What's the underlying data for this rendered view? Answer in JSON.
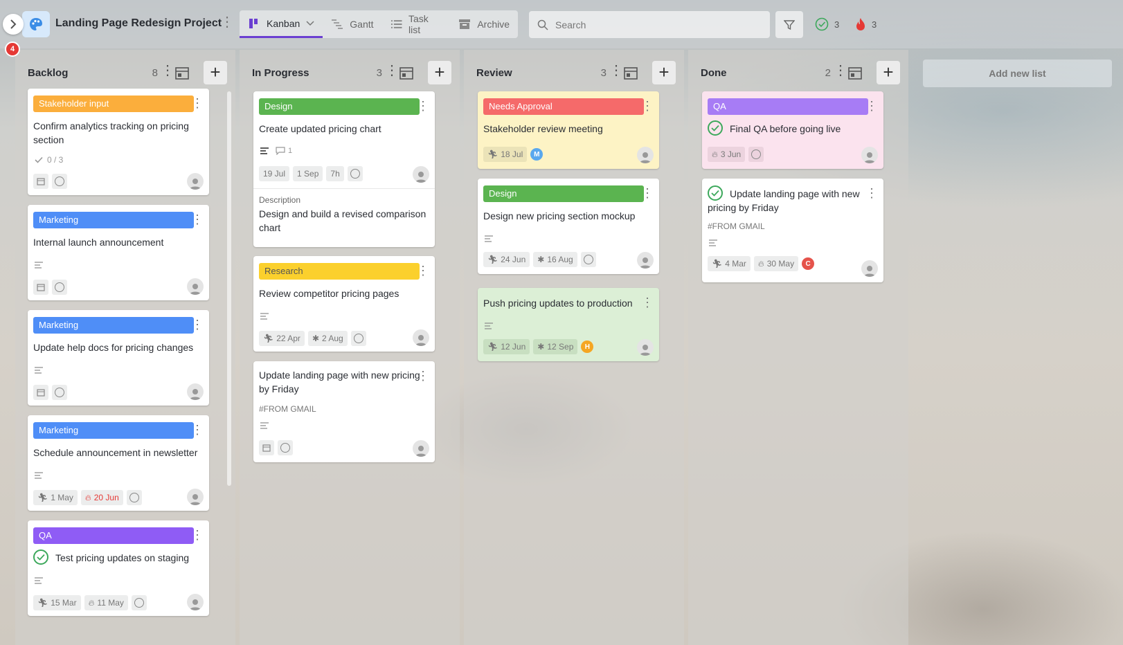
{
  "header": {
    "notification_count": "4",
    "project_title": "Landing Page Redesign Project",
    "tabs": [
      {
        "label": "Kanban",
        "icon": "kanban-icon",
        "active": true
      },
      {
        "label": "Gantt",
        "icon": "gantt-icon"
      },
      {
        "label": "Task list",
        "icon": "list-icon"
      },
      {
        "label": "Archive",
        "icon": "archive-icon"
      }
    ],
    "search_placeholder": "Search",
    "completed_count": "3",
    "overdue_count": "3"
  },
  "colors": {
    "stakeholder": "#fbae3c",
    "marketing": "#4f8ef7",
    "qa": "#8f5cf5",
    "design": "#5bb450",
    "research": "#fbd02d",
    "needs_approval": "#f56a6a",
    "accent": "#6b3fd1"
  },
  "add_list_label": "Add new list",
  "columns": [
    {
      "title": "Backlog",
      "count": "8",
      "cards": [
        {
          "label": "Stakeholder input",
          "title_1": "Confirm analytics tracking on pricing",
          "title_2": "section",
          "subtasks": "0 / 3"
        },
        {
          "label": "Marketing",
          "title": "Internal launch announcement"
        },
        {
          "label": "Marketing",
          "title": "Update help docs for pricing changes"
        },
        {
          "label": "Marketing",
          "title": "Schedule announcement in newsletter",
          "start": "1 May",
          "due": "20 Jun"
        },
        {
          "label": "QA",
          "title": "Test pricing updates on staging",
          "start": "15 Mar",
          "due": "11 May"
        }
      ]
    },
    {
      "title": "In Progress",
      "count": "3",
      "cards": [
        {
          "label": "Design",
          "title": "Create updated pricing chart",
          "comments": "1",
          "start": "19 Jul",
          "due": "1 Sep",
          "estimate": "7h",
          "desc_label": "Description",
          "desc": "Design and build a revised comparison chart"
        },
        {
          "label": "Research",
          "title": "Review competitor pricing pages",
          "start": "22 Apr",
          "due": "2 Aug"
        },
        {
          "title_1": "Update landing page with new pricing",
          "title_2": "by Friday",
          "tag": "#FROM GMAIL"
        }
      ]
    },
    {
      "title": "Review",
      "count": "3",
      "cards": [
        {
          "label": "Needs Approval",
          "title": "Stakeholder review meeting",
          "start": "18 Jul",
          "assignee": "M"
        },
        {
          "label": "Design",
          "title": "Design new pricing section mockup",
          "start": "24 Jun",
          "due": "16 Aug"
        },
        {
          "title": "Push pricing updates to production",
          "start": "12 Jun",
          "due": "12 Sep",
          "assignee": "H"
        }
      ]
    },
    {
      "title": "Done",
      "count": "2",
      "cards": [
        {
          "label": "QA",
          "title": "Final QA before going live",
          "due": "3 Jun"
        },
        {
          "title_1": "Update landing page with new",
          "title_2": "pricing by Friday",
          "tag": "#FROM GMAIL",
          "start": "4 Mar",
          "due": "30 May",
          "assignee": "C"
        }
      ]
    }
  ]
}
